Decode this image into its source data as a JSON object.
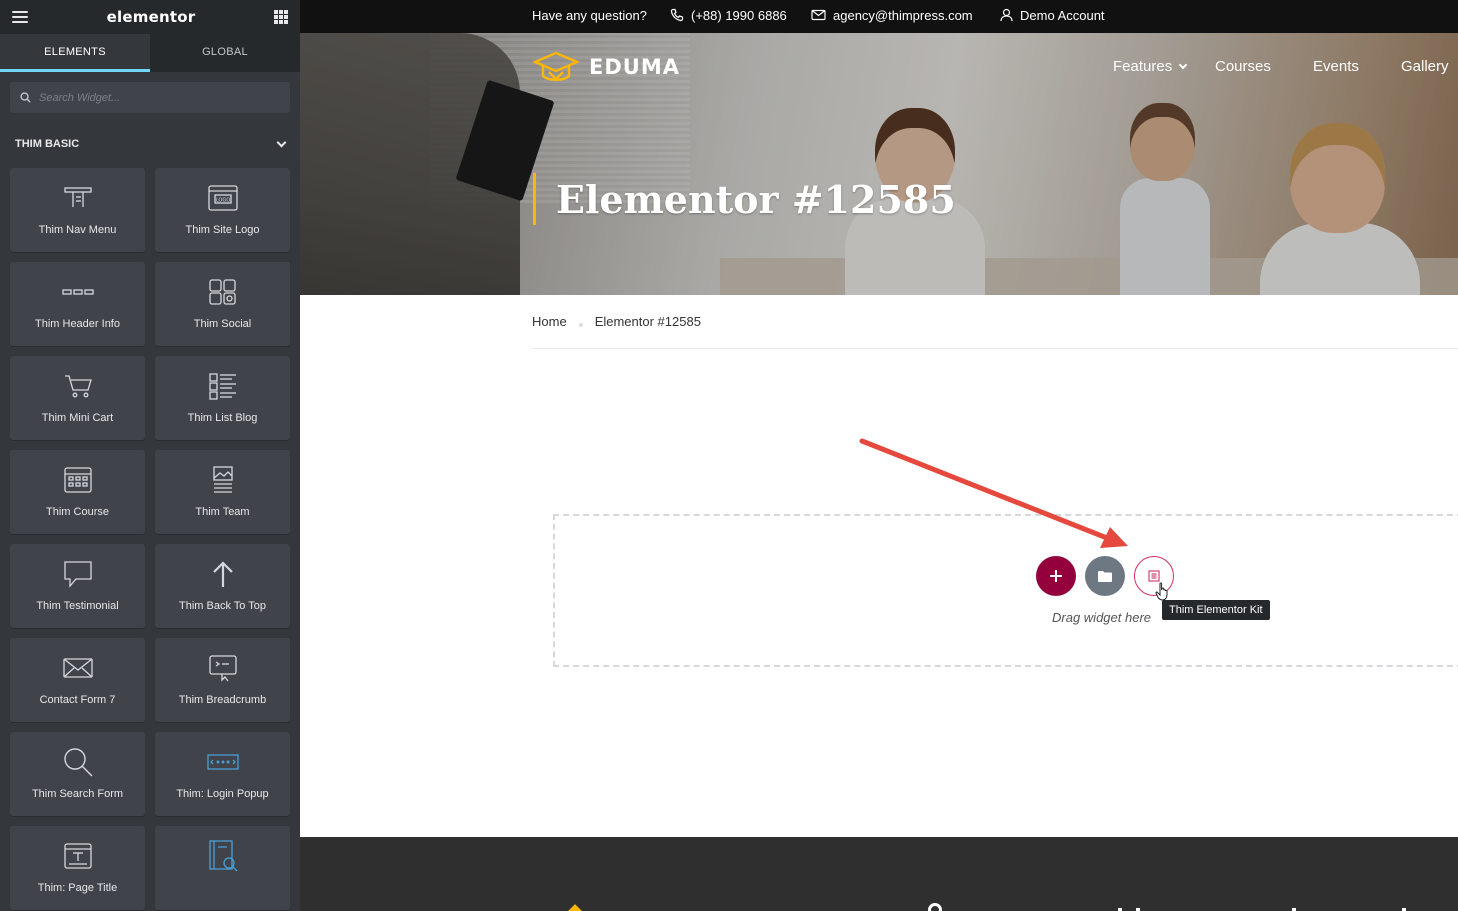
{
  "editor": {
    "logo": "elementor",
    "tabs": [
      {
        "label": "ELEMENTS",
        "active": true
      },
      {
        "label": "GLOBAL",
        "active": false
      }
    ],
    "search_placeholder": "Search Widget...",
    "category": "THIM BASIC",
    "accent_color": "#71d7f7",
    "widgets": [
      {
        "label": "Thim Nav Menu",
        "icon": "nav-menu-icon"
      },
      {
        "label": "Thim Site Logo",
        "icon": "site-logo-icon"
      },
      {
        "label": "Thim Header Info",
        "icon": "header-info-icon"
      },
      {
        "label": "Thim Social",
        "icon": "social-icon"
      },
      {
        "label": "Thim Mini Cart",
        "icon": "cart-icon"
      },
      {
        "label": "Thim List Blog",
        "icon": "list-blog-icon"
      },
      {
        "label": "Thim Course",
        "icon": "course-icon"
      },
      {
        "label": "Thim Team",
        "icon": "team-icon"
      },
      {
        "label": "Thim Testimonial",
        "icon": "speech-bubble-icon"
      },
      {
        "label": "Thim Back To Top",
        "icon": "arrow-up-icon"
      },
      {
        "label": "Contact Form 7",
        "icon": "envelope-icon"
      },
      {
        "label": "Thim Breadcrumb",
        "icon": "breadcrumb-icon"
      },
      {
        "label": "Thim Search Form",
        "icon": "search-icon"
      },
      {
        "label": "Thim: Login Popup",
        "icon": "login-popup-icon"
      },
      {
        "label": "Thim: Page Title",
        "icon": "page-title-icon"
      },
      {
        "label": "",
        "icon": "course-search-icon"
      }
    ]
  },
  "site": {
    "topbar": {
      "question": "Have any question?",
      "phone": "(+88) 1990 6886",
      "email": "agency@thimpress.com",
      "account": "Demo Account"
    },
    "logo_text": "EDUMA",
    "logo_color": "#ffb606",
    "nav": [
      "Features",
      "Courses",
      "Events",
      "Gallery"
    ],
    "page_title": "Elementor #12585",
    "breadcrumb": [
      "Home",
      "Elementor #12585"
    ],
    "drop_zone": {
      "text": "Drag widget here",
      "tooltip": "Thim Elementor Kit",
      "add_color": "#93003c"
    }
  }
}
